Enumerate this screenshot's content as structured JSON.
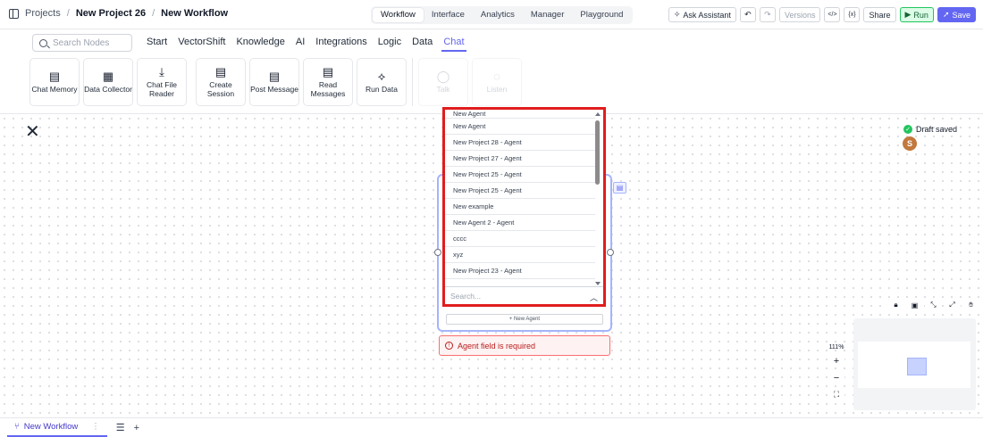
{
  "breadcrumb": {
    "root": "Projects",
    "sep1": "/",
    "project": "New Project 26",
    "sep2": "/",
    "workflow": "New Workflow"
  },
  "tabs": [
    "Workflow",
    "Interface",
    "Analytics",
    "Manager",
    "Playground"
  ],
  "active_tab": "Workflow",
  "header_actions": {
    "ask_assistant": "Ask Assistant",
    "undo_icon": "↶",
    "redo_icon": "↷",
    "versions": "Versions",
    "code_icon": "</>",
    "vars_icon": "{x}",
    "share": "Share",
    "run": "Run",
    "save": "Save"
  },
  "search_nodes": {
    "placeholder": "Search Nodes"
  },
  "categories": [
    "Start",
    "VectorShift",
    "Knowledge",
    "AI",
    "Integrations",
    "Logic",
    "Data",
    "Chat"
  ],
  "active_category": "Chat",
  "node_buttons": [
    {
      "label": "Chat Memory",
      "icon": "chat-memory-icon",
      "glyph": "▤"
    },
    {
      "label": "Data Collector",
      "icon": "data-collector-icon",
      "glyph": "▦"
    },
    {
      "label": "Chat File Reader",
      "icon": "upload-icon",
      "glyph": "⤓"
    },
    {
      "label": "Create Session",
      "icon": "chat-icon",
      "glyph": "▤"
    },
    {
      "label": "Post Message",
      "icon": "message-icon",
      "glyph": "▤"
    },
    {
      "label": "Read Messages",
      "icon": "message-read-icon",
      "glyph": "▤"
    },
    {
      "label": "Run Data",
      "icon": "sparkle-icon",
      "glyph": "⟡"
    },
    {
      "label": "Talk",
      "icon": "talk-icon",
      "glyph": "◯"
    },
    {
      "label": "Listen",
      "icon": "ear-icon",
      "glyph": "◌"
    }
  ],
  "close_glyph": "✕",
  "status": {
    "draft": "Draft saved",
    "avatar_initial": "S"
  },
  "agent_dropdown": {
    "items": [
      "New Agent",
      "New Agent",
      "New Project 28 - Agent",
      "New Project 27 - Agent",
      "New Project 25 - Agent",
      "New Project 25 - Agent",
      "New example",
      "New Agent 2 - Agent",
      "cccc",
      "xyz",
      "New Project 23 - Agent"
    ],
    "search_placeholder": "Search..."
  },
  "agent_card": {
    "new_agent_button": "+ New Agent",
    "error": "Agent field is required"
  },
  "canvas_tools": {
    "zoom_level": "111%",
    "zoom_in": "+",
    "zoom_out": "−",
    "fit": "⛶"
  },
  "footer": {
    "workflow_tab": "New Workflow",
    "kebab": "⋮",
    "list_icon": "☰",
    "add_icon": "+"
  }
}
